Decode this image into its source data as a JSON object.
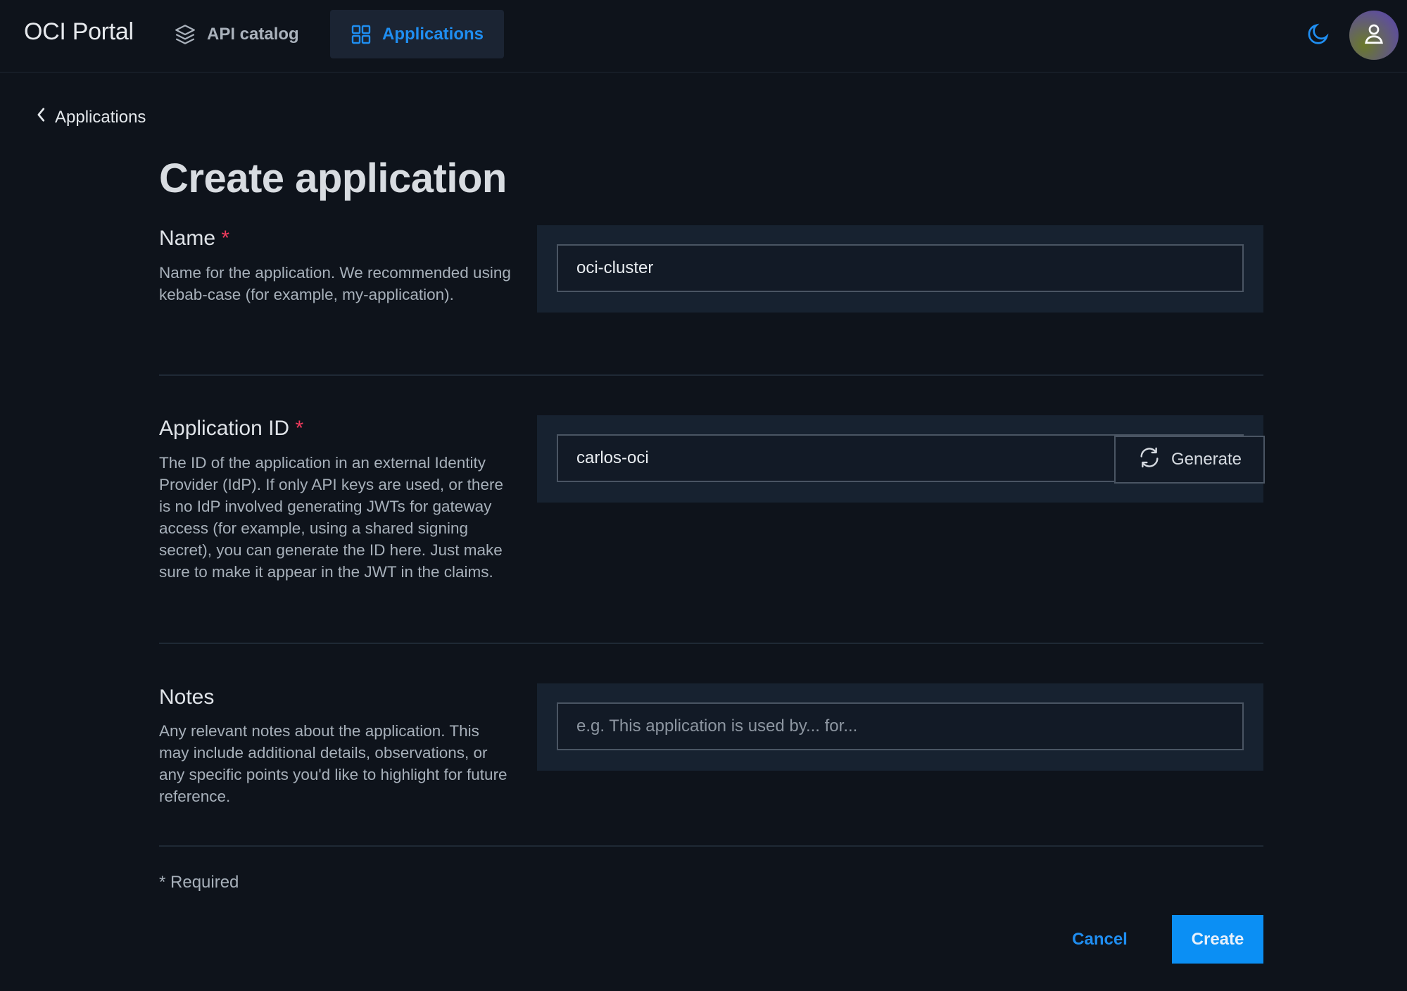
{
  "header": {
    "brand": "OCI Portal",
    "nav": [
      {
        "label": "API catalog",
        "icon": "layers-icon",
        "active": false
      },
      {
        "label": "Applications",
        "icon": "grid-icon",
        "active": true
      }
    ],
    "theme_toggle_icon": "moon-icon",
    "avatar_icon": "user-icon"
  },
  "breadcrumb": {
    "back_label": "Applications"
  },
  "page": {
    "title": "Create application"
  },
  "fields": {
    "name": {
      "label": "Name",
      "required_mark": "*",
      "description": "Name for the application. We recommended using kebab-case (for example, my-application).",
      "value": "oci-cluster"
    },
    "app_id": {
      "label": "Application ID",
      "required_mark": "*",
      "description": "The ID of the application in an external Identity Provider (IdP). If only API keys are used, or there is no IdP involved generating JWTs for gateway access (for example, using a shared signing secret), you can generate the ID here. Just make sure to make it appear in the JWT in the claims.",
      "value": "carlos-oci",
      "generate_label": "Generate"
    },
    "notes": {
      "label": "Notes",
      "description": "Any relevant notes about the application. This may include additional details, observations, or any specific points you'd like to highlight for future reference.",
      "value": "",
      "placeholder": "e.g. This application is used by... for..."
    }
  },
  "footer": {
    "required_note": "* Required",
    "cancel_label": "Cancel",
    "create_label": "Create"
  },
  "colors": {
    "background": "#0e131b",
    "panel": "#172230",
    "accent": "#1f8ef1",
    "primary_button": "#0b8ff4",
    "required": "#ef3b5d"
  }
}
